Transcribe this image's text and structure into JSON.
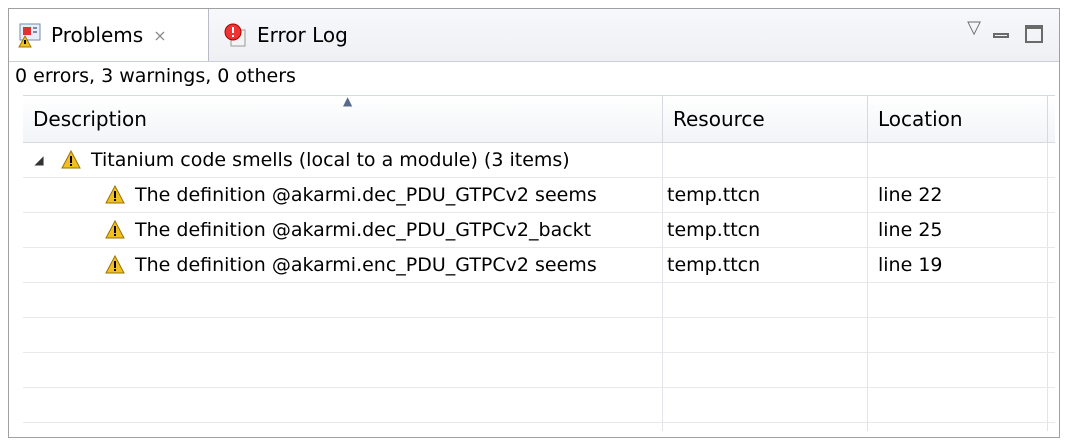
{
  "tabs": [
    {
      "label": "Problems",
      "icon": "problems-icon",
      "active": true,
      "close": "⨯"
    },
    {
      "label": "Error Log",
      "icon": "error-log-icon",
      "active": false
    }
  ],
  "summary": "0 errors, 3 warnings, 0 others",
  "columns": [
    "Description",
    "Resource",
    "Location"
  ],
  "group": {
    "label": "Titanium code smells (local to a module) (3 items)",
    "expanded": true,
    "icon": "warning-icon"
  },
  "items": [
    {
      "description": "The definition @akarmi.dec_PDU_GTPCv2 seems",
      "resource": "temp.ttcn",
      "location": "line 22",
      "icon": "warning-icon"
    },
    {
      "description": "The definition @akarmi.dec_PDU_GTPCv2_backt",
      "resource": "temp.ttcn",
      "location": "line 25",
      "icon": "warning-icon"
    },
    {
      "description": "The definition @akarmi.enc_PDU_GTPCv2 seems",
      "resource": "temp.ttcn",
      "location": "line 19",
      "icon": "warning-icon"
    }
  ],
  "colors": {
    "warning": "#f0c020",
    "tab_active_bg": "#ffffff",
    "border": "#a0a0a0"
  }
}
